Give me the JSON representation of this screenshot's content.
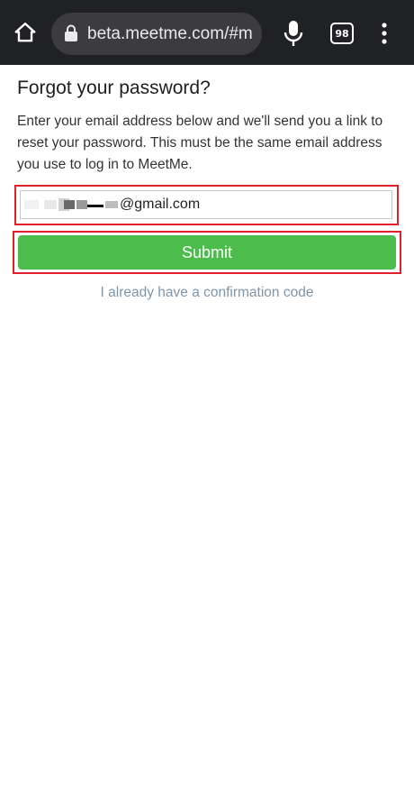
{
  "browser": {
    "url": "beta.meetme.com/#m",
    "tab_count": "98"
  },
  "page": {
    "title": "Forgot your password?",
    "description": "Enter your email address below and we'll send you a link to reset your password. This must be the same email address you use to log in to MeetMe.",
    "email_value_visible": "@gmail.com",
    "submit_label": "Submit",
    "confirmation_link": "I already have a confirmation code"
  },
  "colors": {
    "toolbar_bg": "#202124",
    "submit_green": "#4cbd4c",
    "highlight_red": "#e0202a",
    "link_blue_gray": "#7e95a8"
  },
  "icons": {
    "home": "home-icon",
    "lock": "lock-icon",
    "mic": "microphone-icon",
    "tabs": "tab-switcher-icon",
    "menu": "more-vertical-icon"
  }
}
